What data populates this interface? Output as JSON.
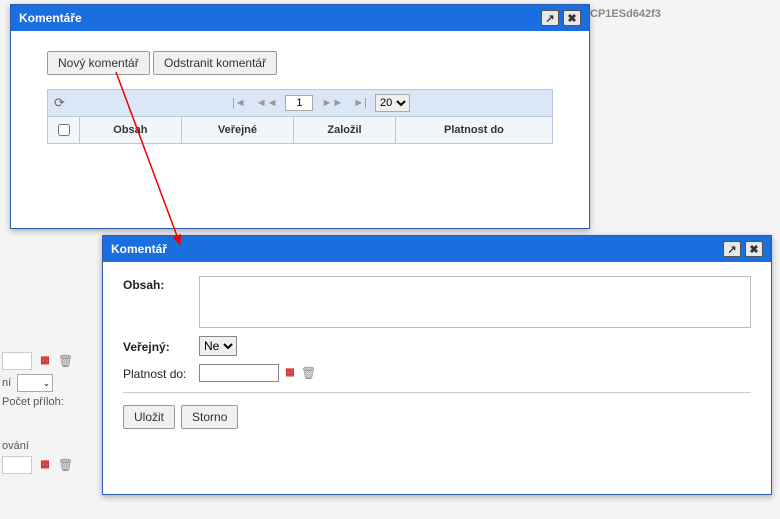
{
  "background": {
    "top_code": "CP1ESd642f3",
    "select_label": "ní",
    "count_label": "Počet příloh:",
    "section_label": "ování"
  },
  "comments_dialog": {
    "title": "Komentáře",
    "btn_new": "Nový komentář",
    "btn_delete": "Odstranit komentář",
    "pager": {
      "page_value": "1",
      "page_size": "20"
    },
    "columns": [
      "Obsah",
      "Veřejné",
      "Založil",
      "Platnost do"
    ]
  },
  "edit_dialog": {
    "title": "Komentář",
    "labels": {
      "obsah": "Obsah:",
      "verejny": "Veřejný:",
      "platnost": "Platnost do:"
    },
    "verejny_value": "Ne",
    "obsah_value": "",
    "platnost_value": "",
    "btn_save": "Uložit",
    "btn_cancel": "Storno"
  }
}
